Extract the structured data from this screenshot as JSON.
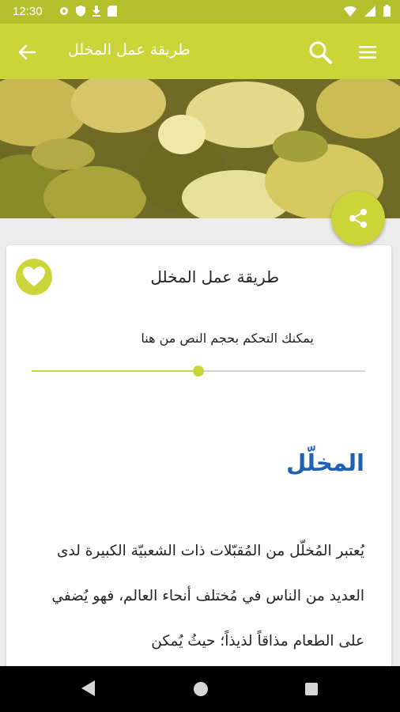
{
  "status_bar": {
    "time": "12:30"
  },
  "app_bar": {
    "title": "طريقة عمل المخلل"
  },
  "card": {
    "title": "طريقة عمل المخلل",
    "text_size_hint": "يمكنك التحكم بحجم النص من هنا",
    "text_size_level": 0.5
  },
  "article": {
    "heading": "المخلّل",
    "body": "يُعتبر المُخلّل من المُقبّلات ذات الشعبيّة الكبيرة لدى العديد من الناس في مُختلف أنحاء العالم، فهو يُضفي على الطعام مذاقاً لذيذاً؛ حيثُ يُمكن"
  },
  "colors": {
    "accent": "#cbd53a",
    "status_bar": "#b4bf2c",
    "heading": "#1f5fb8"
  },
  "icons": [
    "back-arrow-icon",
    "search-icon",
    "menu-icon",
    "share-icon",
    "heart-icon"
  ]
}
